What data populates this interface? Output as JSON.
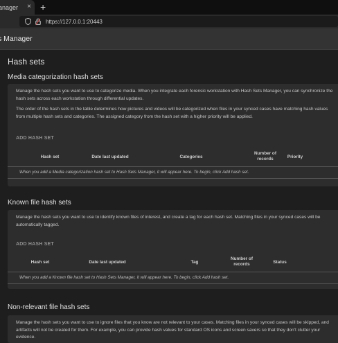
{
  "browser": {
    "tab_title": "anager",
    "close_glyph": "×",
    "new_tab_glyph": "+",
    "url": "https://127.0.0.1:20443"
  },
  "app": {
    "title": "s Manager"
  },
  "page": {
    "title": "Hash sets"
  },
  "sections": [
    {
      "title": "Media categorization hash sets",
      "description_1": "Manage the hash sets you want to use to categorize media. When you integrate each forensic workstation with Hash Sets Manager, you can synchronize the hash sets across each workstation through differential updates.",
      "description_2": "The order of the hash sets in the table determines how pictures and videos will be categorized when files in your synced cases have matching hash values from multiple hash sets and categories. The assigned category from the hash set with a higher priority will be applied.",
      "add_label": "ADD HASH SET",
      "columns": [
        "Hash set",
        "Date last updated",
        "Categories",
        "Number of records",
        "Priority"
      ],
      "empty_message": "When you add a Media categorization hash set to Hash Sets Manager, it will appear here. To begin, click Add hash set."
    },
    {
      "title": "Known file hash sets",
      "description_1": "Manage the hash sets you want to use to identify known files of interest, and create a tag for each hash set. Matching files in your synced cases will be automatically tagged.",
      "add_label": "ADD HASH SET",
      "columns": [
        "Hash set",
        "Date last updated",
        "Tag",
        "Number of records",
        "Status"
      ],
      "empty_message": "When you add a Known file hash set to Hash Sets Manager, it will appear here. To begin, click Add hash set."
    },
    {
      "title": "Non-relevant file hash sets",
      "description_1": "Manage the hash sets you want to use to ignore files that you know are not relevant to your cases. Matching files in your synced cases will be skipped, and artifacts will not be created for them. For example, you can provide hash values for standard OS icons and screen savers so that they don't clutter your evidence."
    }
  ]
}
